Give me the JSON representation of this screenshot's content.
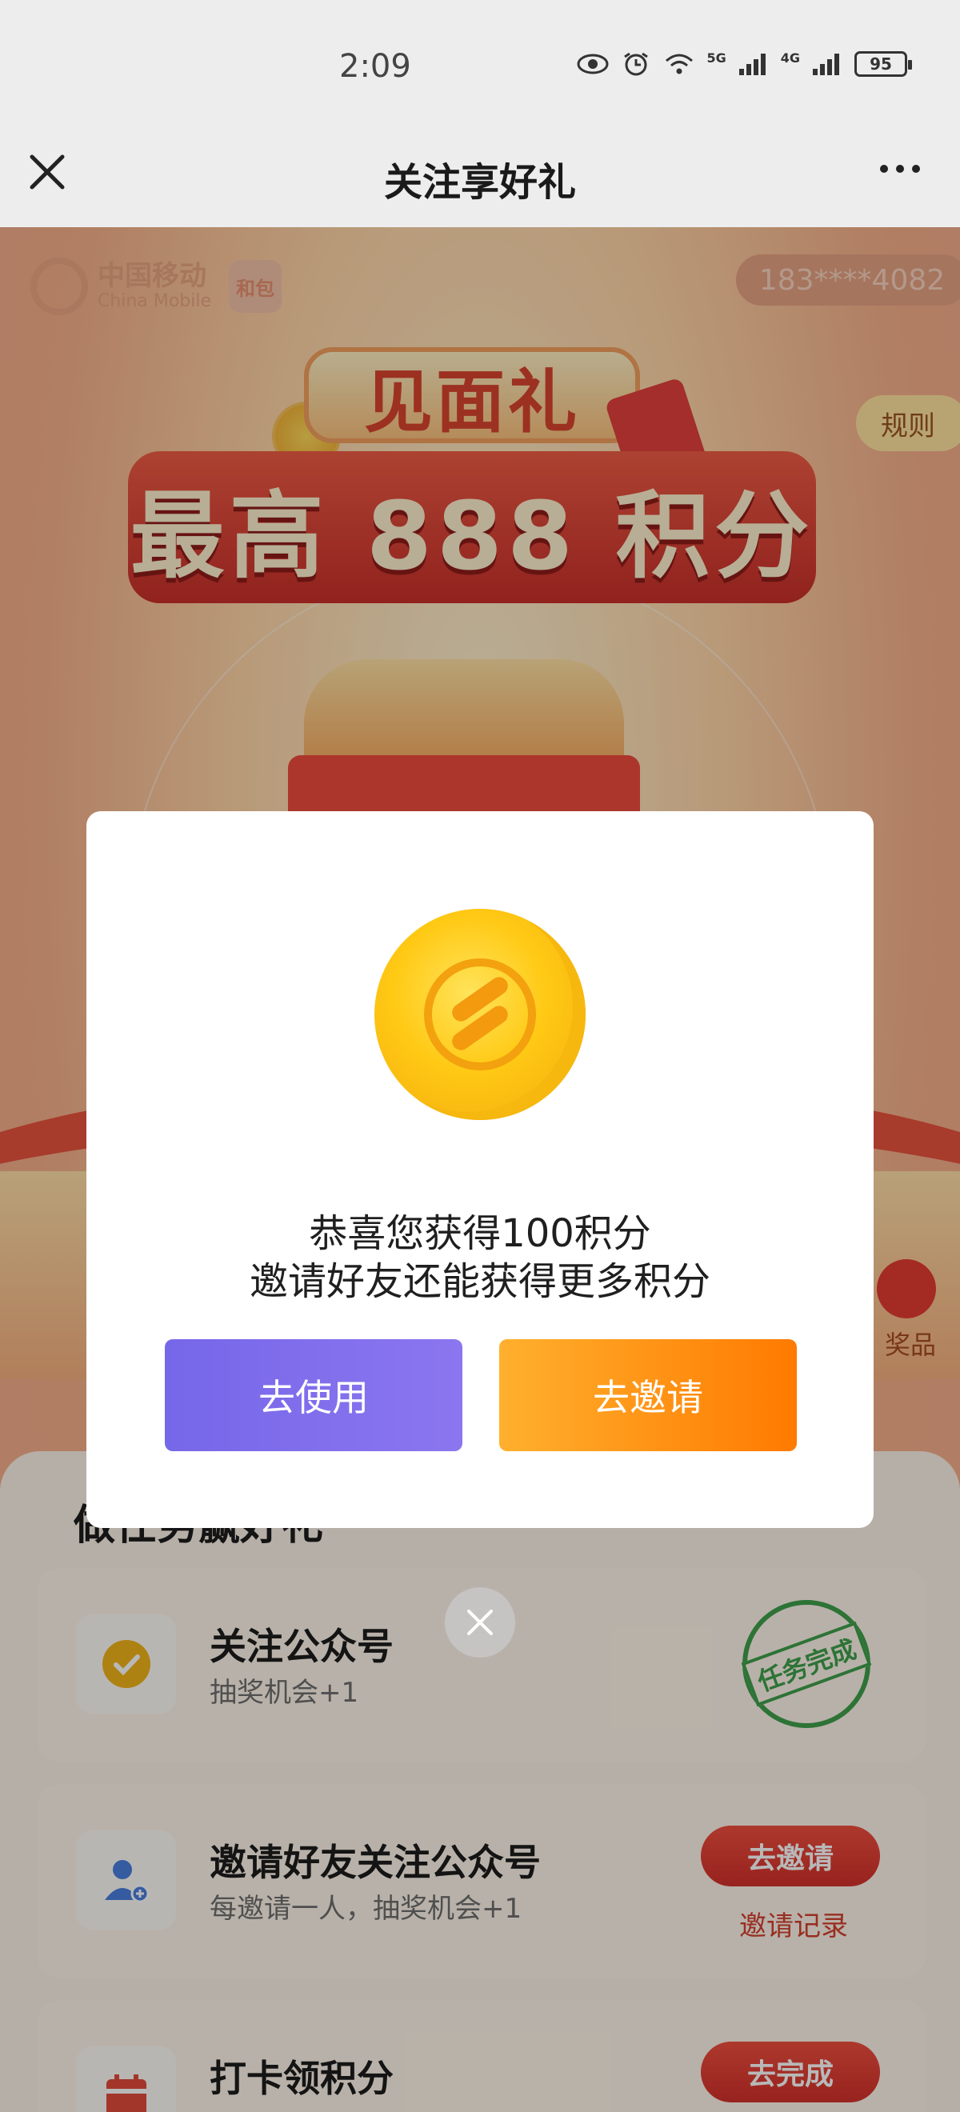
{
  "status_bar": {
    "time": "2:09",
    "sig1_label": "5G",
    "sig2_label": "4G",
    "battery": "95"
  },
  "nav": {
    "title": "关注享好礼"
  },
  "page": {
    "logo_cn": "中国移动",
    "logo_en": "China Mobile",
    "hebao": "和包",
    "phone": "183****4082",
    "rules": "规则",
    "banner_top": "见面礼",
    "banner_main": "最高 888 积分",
    "prize_label": "奖品"
  },
  "tasks": {
    "heading": "做任务赢好礼",
    "items": [
      {
        "title": "关注公众号",
        "subtitle": "抽奖机会+1",
        "stamp": "任务完成"
      },
      {
        "title": "邀请好友关注公众号",
        "subtitle": "每邀请一人，抽奖机会+1",
        "button": "去邀请",
        "link": "邀请记录"
      },
      {
        "title": "打卡领积分",
        "subtitle": "",
        "button": "去完成"
      }
    ]
  },
  "modal": {
    "line1": "恭喜您获得100积分",
    "line2": "邀请好友还能获得更多积分",
    "use_button": "去使用",
    "invite_button": "去邀请"
  },
  "colors": {
    "use_button": "#7667e9",
    "invite_button": "#ff8a00",
    "task_button": "#e3402f",
    "stamp": "#3fa04b"
  },
  "icons": [
    "close-icon",
    "more-icon",
    "eye-icon",
    "alarm-icon",
    "wifi-icon",
    "signal-icon",
    "battery-icon",
    "verified-badge-icon",
    "add-user-icon",
    "calendar-icon",
    "gift-icon",
    "coin-icon"
  ]
}
